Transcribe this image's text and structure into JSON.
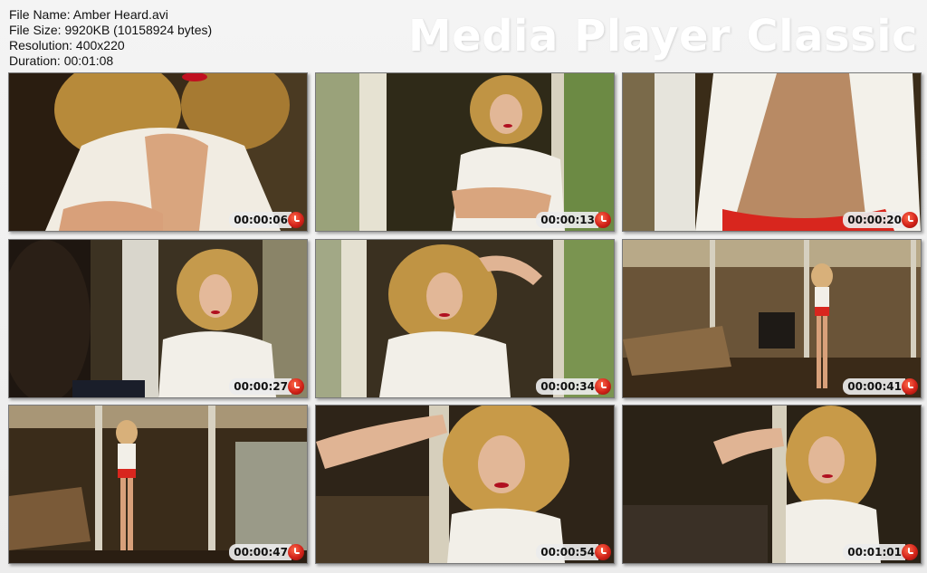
{
  "file_info": {
    "name": "File Name: Amber Heard.avi",
    "size": "File Size: 9920KB (10158924 bytes)",
    "resolution": "Resolution: 400x220",
    "duration": "Duration: 00:01:08"
  },
  "brand": "Media Player Classic",
  "accent_colors": {
    "timestamp_badge": "#d2231a",
    "header_text": "#ffffff"
  },
  "thumbnails": [
    {
      "time": "00:00:06"
    },
    {
      "time": "00:00:13"
    },
    {
      "time": "00:00:20"
    },
    {
      "time": "00:00:27"
    },
    {
      "time": "00:00:34"
    },
    {
      "time": "00:00:41"
    },
    {
      "time": "00:00:47"
    },
    {
      "time": "00:00:54"
    },
    {
      "time": "00:01:01"
    }
  ]
}
